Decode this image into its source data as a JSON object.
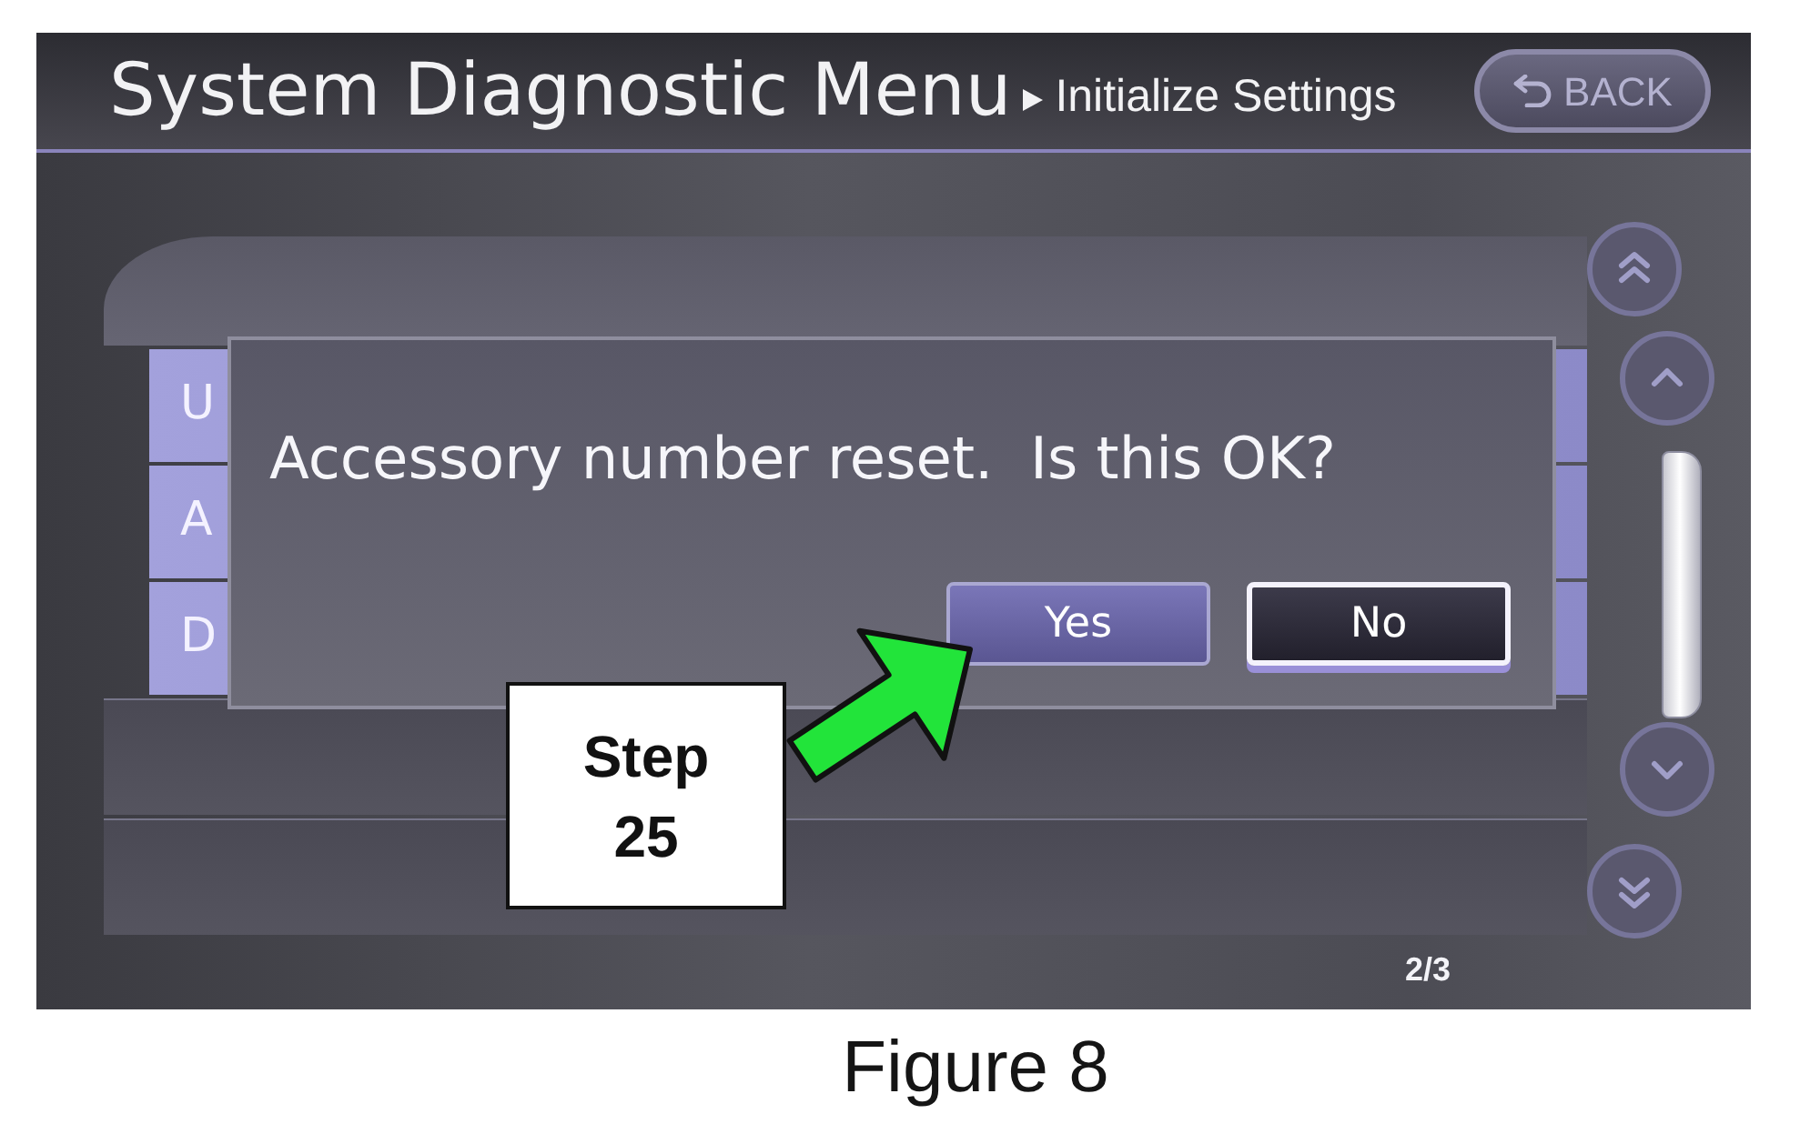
{
  "header": {
    "title": "System Diagnostic Menu",
    "breadcrumb": "Initialize Settings",
    "back_button": {
      "label": "BACK",
      "disabled": true
    }
  },
  "list_items": [
    {
      "label": "U"
    },
    {
      "label": "A"
    },
    {
      "label": "D"
    }
  ],
  "page_indicator": "2/3",
  "dialog": {
    "message": "Accessory number reset.  Is this OK?",
    "buttons": [
      {
        "label": "Yes",
        "selected": false
      },
      {
        "label": "No",
        "selected": true
      }
    ]
  },
  "callout": {
    "lines": [
      "Step",
      "25"
    ]
  },
  "caption": "Figure 8"
}
